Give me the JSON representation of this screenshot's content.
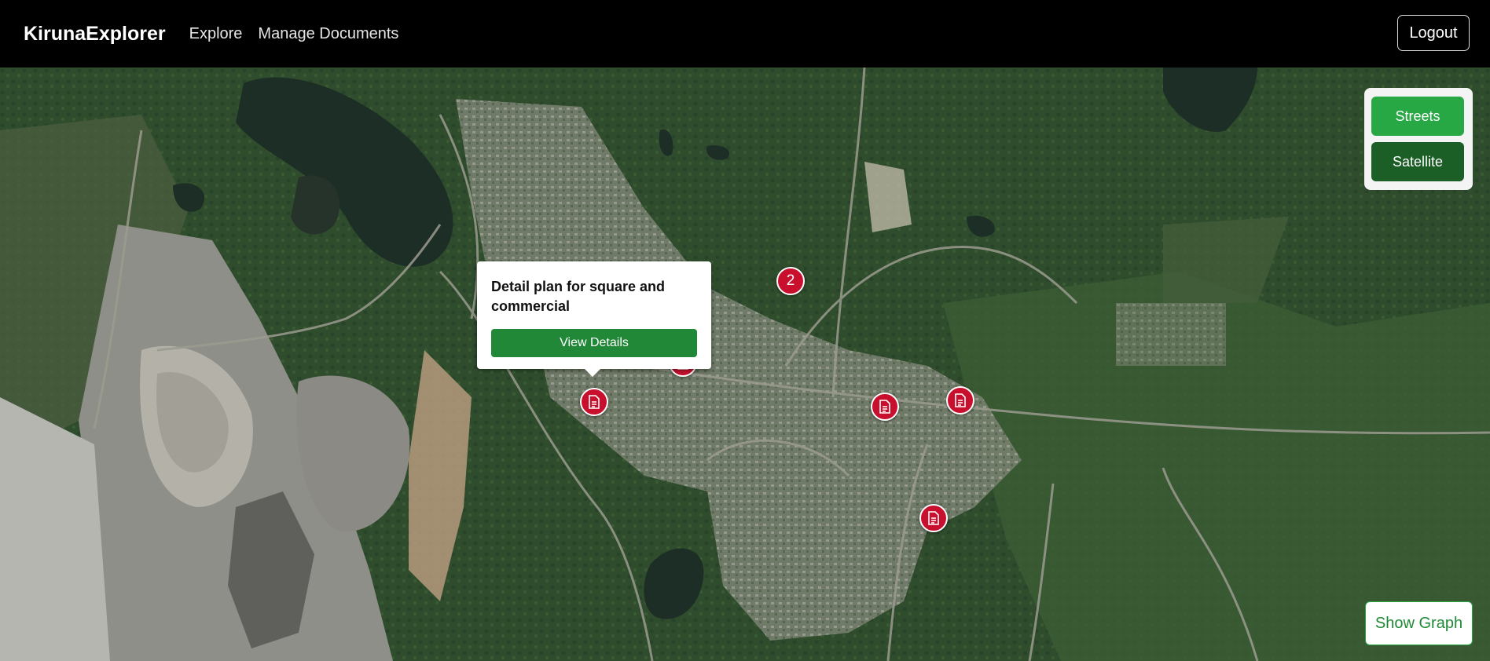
{
  "navbar": {
    "brand": "KirunaExplorer",
    "links": [
      "Explore",
      "Manage Documents"
    ],
    "logout_label": "Logout"
  },
  "layers": {
    "streets_label": "Streets",
    "satellite_label": "Satellite",
    "active": "Satellite"
  },
  "popup": {
    "title": "Detail plan for square and commercial",
    "button_label": "View Details"
  },
  "markers": [
    {
      "type": "cluster",
      "label": "2"
    },
    {
      "type": "document",
      "icon": "document-icon"
    },
    {
      "type": "document",
      "icon": "document-icon"
    },
    {
      "type": "document",
      "icon": "document-icon"
    },
    {
      "type": "document",
      "icon": "document-icon"
    },
    {
      "type": "document",
      "icon": "document-icon"
    }
  ],
  "show_graph_label": "Show Graph",
  "colors": {
    "navbar_bg": "#000000",
    "marker_red": "#c8102e",
    "streets_green": "#28a745",
    "satellite_green": "#1b5e26",
    "details_green": "#218838"
  }
}
